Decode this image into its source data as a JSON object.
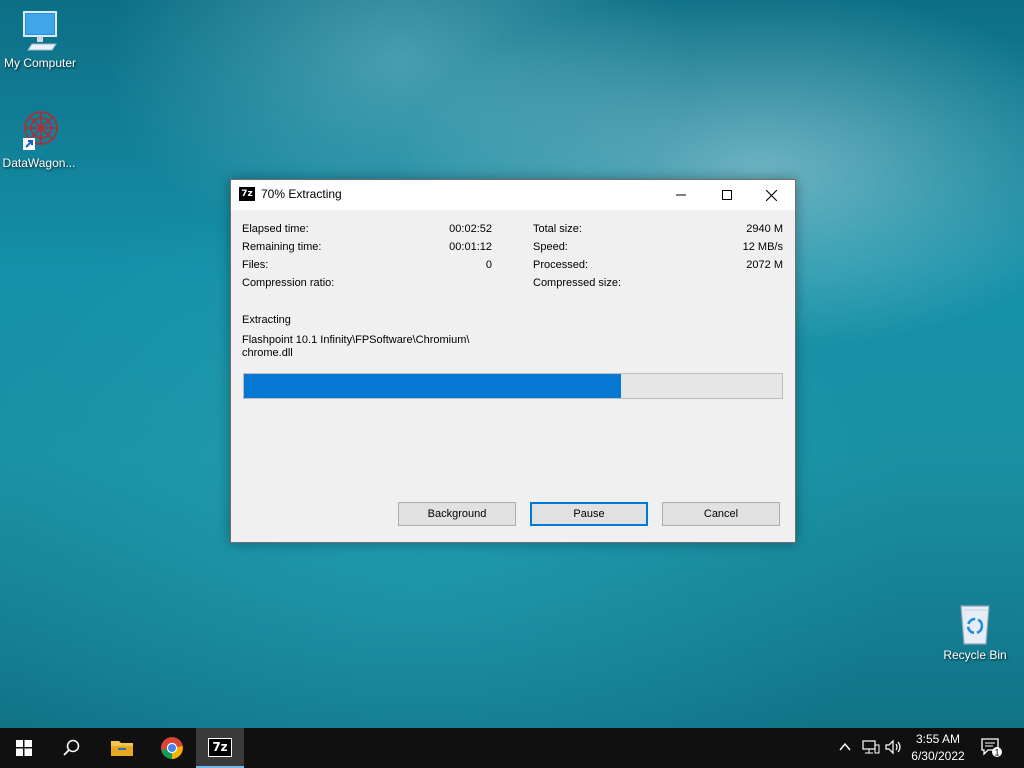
{
  "desktop": {
    "icons": [
      {
        "label": "My Computer",
        "icon": "monitor-icon"
      },
      {
        "label": "DataWagon...",
        "icon": "datawagon-icon"
      },
      {
        "label": "Recycle Bin",
        "icon": "recycle-bin-icon"
      }
    ]
  },
  "dialog": {
    "app_icon_text": "7z",
    "title": "70% Extracting",
    "left_stats": [
      {
        "label": "Elapsed time:",
        "value": "00:02:52"
      },
      {
        "label": "Remaining time:",
        "value": "00:01:12"
      },
      {
        "label": "Files:",
        "value": "0"
      },
      {
        "label": "Compression ratio:",
        "value": ""
      }
    ],
    "right_stats": [
      {
        "label": "Total size:",
        "value": "2940 M"
      },
      {
        "label": "Speed:",
        "value": "12 MB/s"
      },
      {
        "label": "Processed:",
        "value": "2072 M"
      },
      {
        "label": "Compressed size:",
        "value": ""
      }
    ],
    "action_label": "Extracting",
    "current_path_line1": "Flashpoint 10.1 Infinity\\FPSoftware\\Chromium\\",
    "current_path_line2": "chrome.dll",
    "progress_percent": 70,
    "buttons": {
      "background": "Background",
      "pause": "Pause",
      "cancel": "Cancel"
    }
  },
  "taskbar": {
    "items": [
      "start-icon",
      "search-icon",
      "file-explorer-icon",
      "chrome-icon",
      "7zip-icon"
    ],
    "active_item_text": "7z",
    "tray": [
      "chevron-up-icon",
      "network-icon",
      "volume-icon"
    ],
    "time": "3:55 AM",
    "date": "6/30/2022",
    "notification_count": "1"
  },
  "colors": {
    "accent": "#0678d4",
    "taskbar": "#101010"
  }
}
